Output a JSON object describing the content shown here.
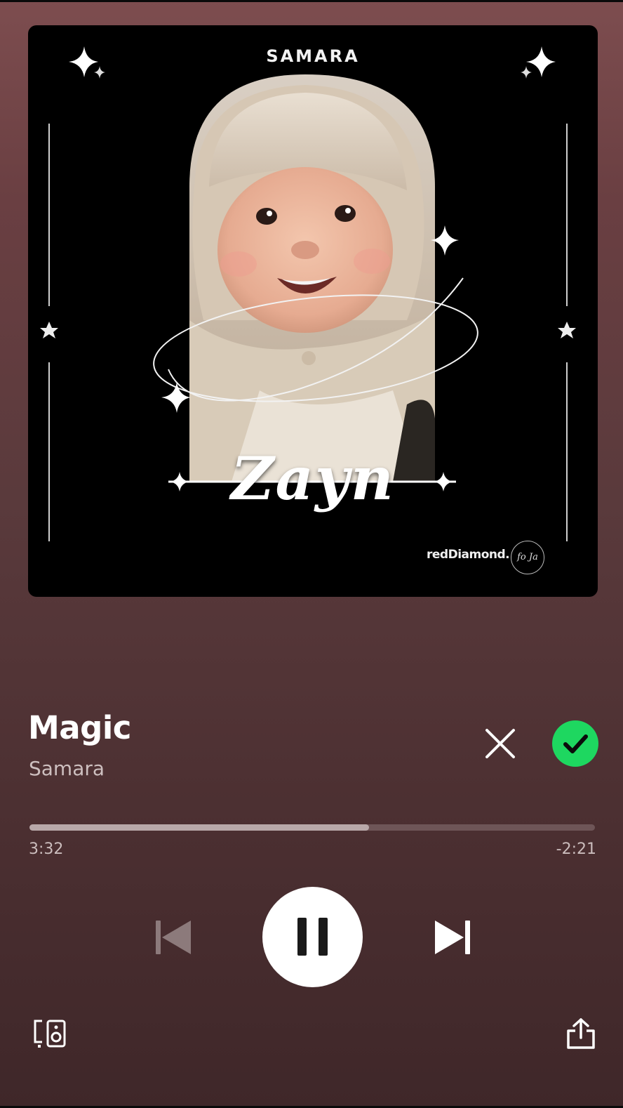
{
  "album_art": {
    "header_text": "SAMARA",
    "featured_name": "Zayn",
    "brand_text": "redDiamond.",
    "logo_text": "fo Ja"
  },
  "track": {
    "title": "Magic",
    "artist": "Samara",
    "liked": true
  },
  "playback": {
    "elapsed": "3:32",
    "remaining": "-2:21",
    "progress_fraction": 0.6,
    "state": "playing"
  },
  "icons": {
    "close": "close-icon",
    "liked": "check-icon",
    "previous": "skip-previous-icon",
    "pause": "pause-icon",
    "next": "skip-next-icon",
    "devices": "connect-devices-icon",
    "share": "share-icon"
  },
  "colors": {
    "accent_green": "#1ed760",
    "background_top": "#7d4d4f",
    "background_bottom": "#3f2729"
  }
}
